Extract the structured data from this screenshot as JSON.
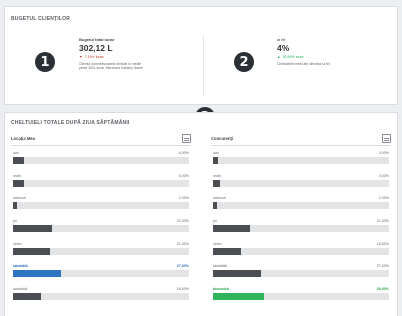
{
  "budget_section": {
    "title": "BUGETUL CLIENȚILOR",
    "marker1": "1",
    "marker2": "2",
    "kpi_left": {
      "label": "Bugetul total lunar",
      "value": "302,12 L",
      "trend": "7,19% lunar",
      "trend_direction": "down",
      "description": "Clientul dumneavoastră cheltuie în medie peste 302L lunar, Merchant Industry Name"
    },
    "kpi_right": {
      "label": "la fel",
      "value": "4%",
      "trend": "30,59% lunar",
      "trend_direction": "up",
      "description": "Cheltuielile medii ale clientilor la fel."
    }
  },
  "expenses_section": {
    "title": "CHELTUIELI TOTALE DUPĂ ZIUA SĂPTĂMÂNII",
    "marker3": "3",
    "left_column": {
      "header": "Locația Mea",
      "icon": "store-icon",
      "rows": [
        {
          "day": "luni",
          "pct": "6,00%",
          "value": 0.06
        },
        {
          "day": "marți",
          "pct": "6,00%",
          "value": 0.06
        },
        {
          "day": "miercuri",
          "pct": "2,00%",
          "value": 0.02
        },
        {
          "day": "joi",
          "pct": "22,00%",
          "value": 0.22
        },
        {
          "day": "vineri",
          "pct": "21,00%",
          "value": 0.21
        },
        {
          "day": "sâmbătă",
          "pct": "27,00%",
          "value": 0.27,
          "highlight": "blue"
        },
        {
          "day": "duminică",
          "pct": "16,00%",
          "value": 0.16
        }
      ]
    },
    "right_column": {
      "header": "Concurenți",
      "icon": "competitors-icon",
      "rows": [
        {
          "day": "luni",
          "pct": "3,00%",
          "value": 0.03
        },
        {
          "day": "marți",
          "pct": "4,00%",
          "value": 0.04
        },
        {
          "day": "miercuri",
          "pct": "2,00%",
          "value": 0.02
        },
        {
          "day": "joi",
          "pct": "21,00%",
          "value": 0.21
        },
        {
          "day": "vineri",
          "pct": "16,00%",
          "value": 0.16
        },
        {
          "day": "sâmbătă",
          "pct": "27,00%",
          "value": 0.27
        },
        {
          "day": "duminică",
          "pct": "29,00%",
          "value": 0.29,
          "highlight": "green"
        }
      ]
    }
  },
  "colors": {
    "accent_blue": "#2f74c0",
    "accent_green": "#2eb35a",
    "bar_dark": "#4a4d52"
  }
}
